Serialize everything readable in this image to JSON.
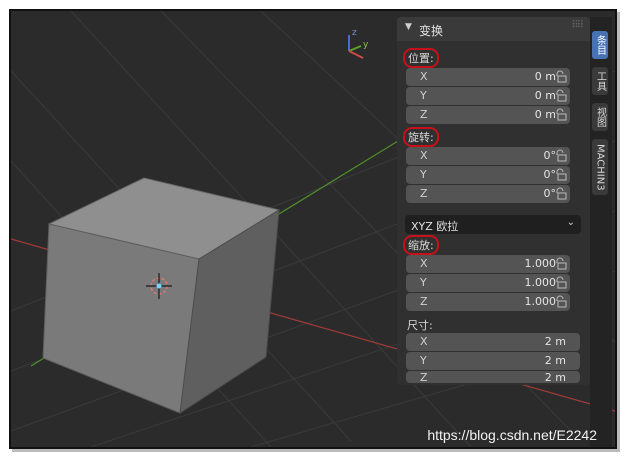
{
  "panel": {
    "header_title": "变换",
    "location": {
      "label": "位置:",
      "fields": [
        {
          "axis": "X",
          "value": "0 m"
        },
        {
          "axis": "Y",
          "value": "0 m"
        },
        {
          "axis": "Z",
          "value": "0 m"
        }
      ]
    },
    "rotation": {
      "label": "旋转:",
      "fields": [
        {
          "axis": "X",
          "value": "0°"
        },
        {
          "axis": "Y",
          "value": "0°"
        },
        {
          "axis": "Z",
          "value": "0°"
        }
      ],
      "mode": "XYZ 欧拉"
    },
    "scale": {
      "label": "缩放:",
      "fields": [
        {
          "axis": "X",
          "value": "1.000"
        },
        {
          "axis": "Y",
          "value": "1.000"
        },
        {
          "axis": "Z",
          "value": "1.000"
        }
      ]
    },
    "dimensions": {
      "label": "尺寸:",
      "fields": [
        {
          "axis": "X",
          "value": "2 m"
        },
        {
          "axis": "Y",
          "value": "2 m"
        },
        {
          "axis": "Z",
          "value": "2 m"
        }
      ]
    }
  },
  "tabs": [
    "条目",
    "工具",
    "视图",
    "MACHIN3"
  ],
  "gizmo": {
    "x": "x",
    "y": "y",
    "z": "z"
  },
  "watermark": "https://blog.csdn.net/E2242",
  "colors": {
    "highlight_circle": "#c8101a",
    "active_tab": "#4772b3",
    "x_axis": "#c84b4b",
    "y_axis": "#6a9a2a"
  }
}
